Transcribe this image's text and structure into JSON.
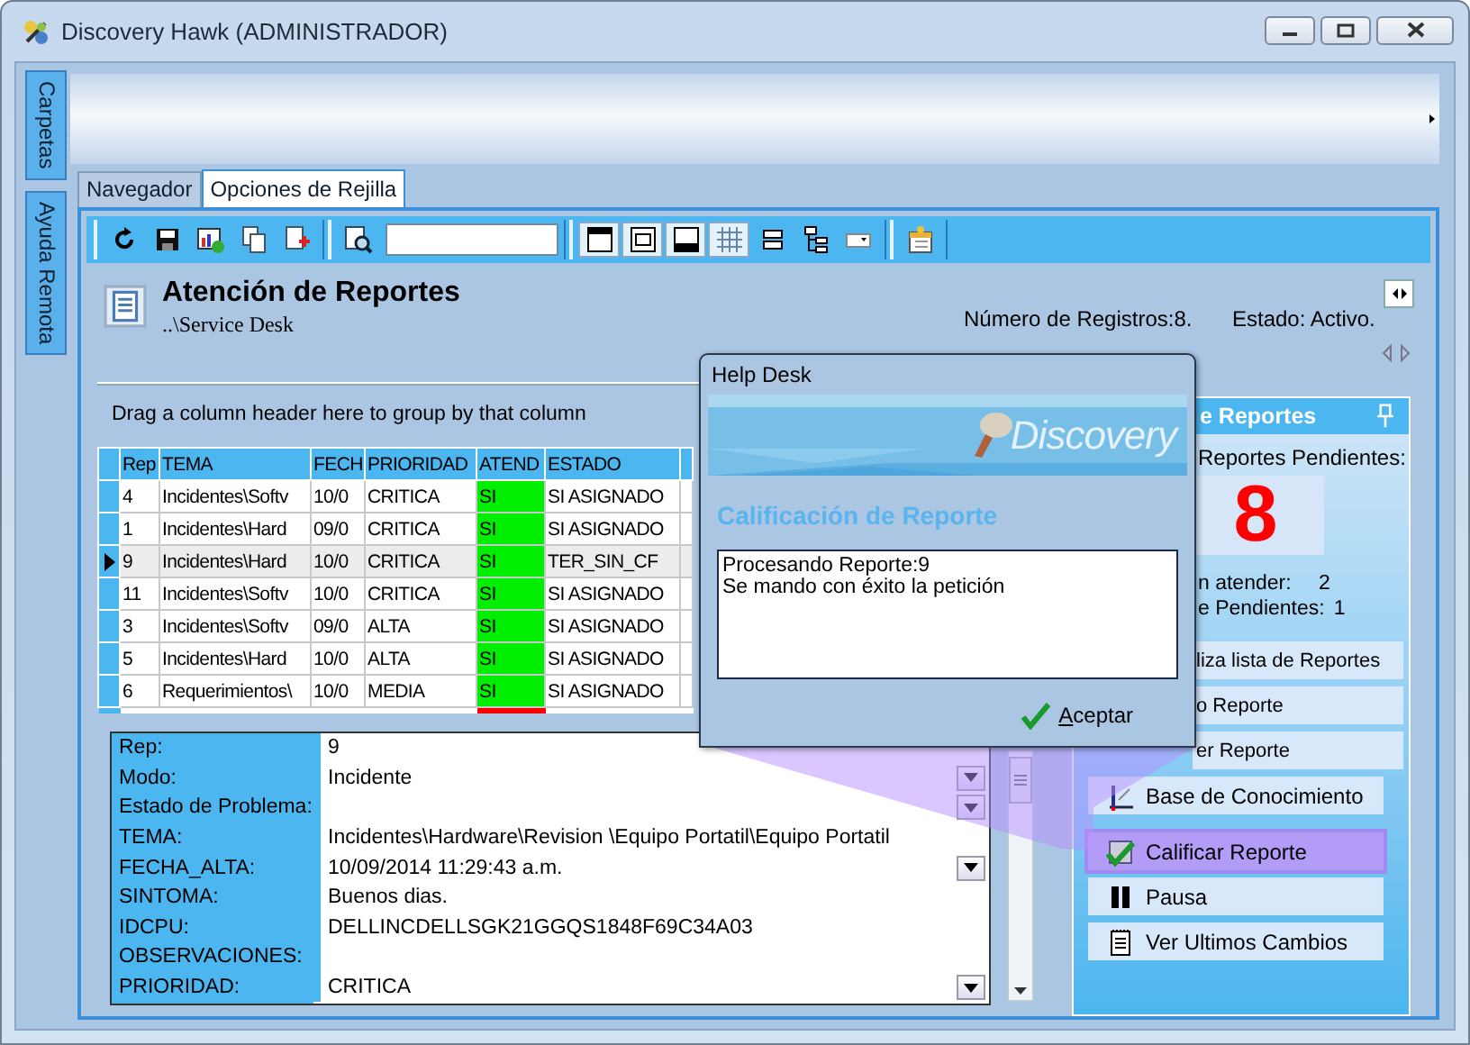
{
  "window": {
    "title": "Discovery Hawk (ADMINISTRADOR)"
  },
  "side_tabs": [
    {
      "label": "Carpetas"
    },
    {
      "label": "Ayuda Remota"
    }
  ],
  "tabs": [
    {
      "label": "Navegador",
      "selected": false
    },
    {
      "label": "Opciones de Rejilla",
      "selected": true
    }
  ],
  "header": {
    "title": "Atención de Reportes",
    "path": "..\\Service Desk",
    "record_count": "Número de Registros:8.",
    "status": "Estado: Activo."
  },
  "grid": {
    "group_hint": "Drag a column header here to group by that column",
    "columns": [
      "Rep",
      "TEMA",
      "FECH",
      "PRIORIDAD",
      "ATEND",
      "ESTADO"
    ],
    "rows": [
      {
        "cells": [
          "4",
          "Incidentes\\Softv",
          "10/0",
          "CRITICA",
          "SI",
          "SI ASIGNADO"
        ],
        "color": "#00ee00",
        "selected": false
      },
      {
        "cells": [
          "1",
          "Incidentes\\Hard",
          "09/0",
          "CRITICA",
          "SI",
          "SI ASIGNADO"
        ],
        "color": "#00ee00",
        "selected": false
      },
      {
        "cells": [
          "9",
          "Incidentes\\Hard",
          "10/0",
          "CRITICA",
          "SI",
          "TER_SIN_CF"
        ],
        "color": "#00ee00",
        "selected": true
      },
      {
        "cells": [
          "11",
          "Incidentes\\Softv",
          "10/0",
          "CRITICA",
          "SI",
          "SI ASIGNADO"
        ],
        "color": "#00ee00",
        "selected": false
      },
      {
        "cells": [
          "3",
          "Incidentes\\Softv",
          "09/0",
          "ALTA",
          "SI",
          "SI ASIGNADO"
        ],
        "color": "#00ee00",
        "selected": false
      },
      {
        "cells": [
          "5",
          "Incidentes\\Hard",
          "10/0",
          "ALTA",
          "SI",
          "SI ASIGNADO"
        ],
        "color": "#00ee00",
        "selected": false
      },
      {
        "cells": [
          "6",
          "Requerimientos\\",
          "10/0",
          "MEDIA",
          "SI",
          "SI ASIGNADO"
        ],
        "color": "#00ee00",
        "selected": false
      },
      {
        "kind": "partial",
        "color": "#ff0000"
      }
    ]
  },
  "details": {
    "fields": [
      {
        "label": "Rep:",
        "value": "9",
        "kind": "text"
      },
      {
        "label": "Modo:",
        "value": "Incidente",
        "kind": "dropdown"
      },
      {
        "label": "Estado de Problema:",
        "kind": "dropdown"
      },
      {
        "label": "TEMA:",
        "value": "Incidentes\\Hardware\\Revision \\Equipo Portatil\\Equipo Portatil",
        "kind": "text"
      },
      {
        "label": "FECHA_ALTA:",
        "value": "10/09/2014 11:29:43 a.m.",
        "kind": "dropdown"
      },
      {
        "label": "SINTOMA:",
        "value": "Buenos dias.",
        "kind": "text"
      },
      {
        "label": "IDCPU:",
        "value": "DELLINCDELLSGK21GGQS1848F69C34A03",
        "kind": "text"
      },
      {
        "label": "OBSERVACIONES:",
        "kind": "text"
      },
      {
        "label": "PRIORIDAD:",
        "value": "CRITICA",
        "kind": "dropdown"
      }
    ]
  },
  "side_panel": {
    "title": "e Reportes",
    "pending_label": "Reportes Pendientes:",
    "pending_count": "8",
    "stats": [
      {
        "label": "n atender:",
        "value": "2"
      },
      {
        "label": "e Pendientes:",
        "value": "1"
      }
    ],
    "buttons": [
      {
        "label": "liza lista de Reportes",
        "kind": "covered",
        "selected": false
      },
      {
        "label": "o Reporte",
        "kind": "covered",
        "selected": false
      },
      {
        "label": "er Reporte",
        "kind": "covered",
        "selected": false
      },
      {
        "label": "Base de Conocimiento",
        "kind": "full",
        "selected": false
      },
      {
        "label": "Calificar Reporte",
        "kind": "full",
        "selected": true
      },
      {
        "label": "Pausa",
        "kind": "full",
        "selected": false
      },
      {
        "label": "Ver Ultimos Cambios",
        "kind": "full",
        "selected": false
      }
    ]
  },
  "dialog": {
    "title": "Help Desk",
    "logo": "Discovery",
    "heading": "Calificación de Reporte",
    "message": [
      "Procesando Reporte:9",
      "Se mando con éxito la petición"
    ],
    "button": "Aceptar"
  }
}
